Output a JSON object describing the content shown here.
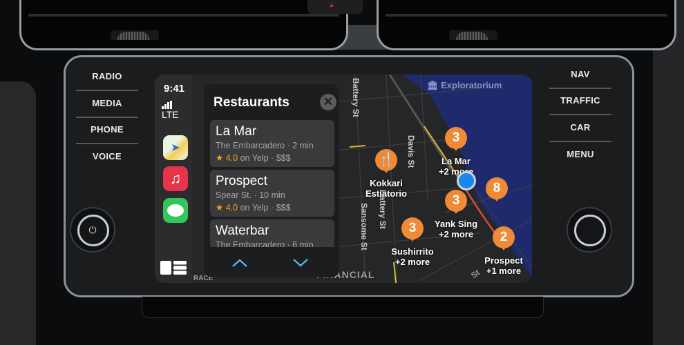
{
  "hardware": {
    "left_buttons": [
      "RADIO",
      "MEDIA",
      "PHONE",
      "VOICE"
    ],
    "right_buttons": [
      "NAV",
      "TRAFFIC",
      "CAR",
      "MENU"
    ],
    "power_icon": "⏻"
  },
  "status": {
    "time": "9:41",
    "network": "LTE"
  },
  "dock": {
    "apps": [
      {
        "name": "Maps",
        "icon": "maps-icon",
        "glyph": "➤"
      },
      {
        "name": "Music",
        "icon": "music-icon",
        "glyph": "♫"
      },
      {
        "name": "Messages",
        "icon": "messages-icon",
        "glyph": "💬"
      }
    ]
  },
  "panel": {
    "title": "Restaurants",
    "close_glyph": "✕",
    "items": [
      {
        "name": "La Mar",
        "location": "The Embarcadero · 2 min",
        "star": "★",
        "rating": "4.0",
        "rating_suffix": " on Yelp · $$$"
      },
      {
        "name": "Prospect",
        "location": "Spear St. · 10 min",
        "star": "★",
        "rating": "4.0",
        "rating_suffix": " on Yelp · $$$"
      },
      {
        "name": "Waterbar",
        "location": "The Embarcadero · 6 min",
        "star": "",
        "rating": "",
        "rating_suffix": ""
      }
    ]
  },
  "map": {
    "landmark": "Exploratorium",
    "streets": [
      "Battery St",
      "Davis St",
      "Sansome St",
      "Battery St",
      "FINANCIAL",
      "RACE",
      "St"
    ],
    "pins": [
      {
        "count": "3",
        "label1": "La Mar",
        "label2": "+2 more"
      },
      {
        "count": "",
        "label1": "Kokkari",
        "label2": "Estiatorio"
      },
      {
        "count": "8",
        "label1": "",
        "label2": ""
      },
      {
        "count": "3",
        "label1": "Yank Sing",
        "label2": "+2 more"
      },
      {
        "count": "3",
        "label1": "Sushirrito",
        "label2": "+2 more"
      },
      {
        "count": "2",
        "label1": "Prospect",
        "label2": "+1 more"
      }
    ],
    "colors": {
      "pin": "#ef8a36",
      "location": "#1a86f0",
      "water": "#1e2a6b"
    }
  }
}
